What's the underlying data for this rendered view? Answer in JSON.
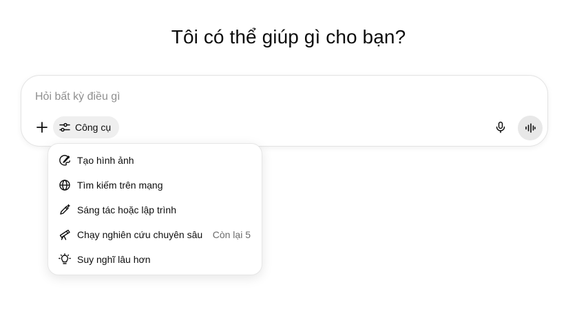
{
  "heading": "Tôi có thể giúp gì cho bạn?",
  "composer": {
    "placeholder": "Hỏi bất kỳ điều gì",
    "value": "",
    "tools_label": "Công cụ"
  },
  "tools_menu": {
    "items": [
      {
        "label": "Tạo hình ảnh",
        "icon": "image-brush-icon"
      },
      {
        "label": "Tìm kiếm trên mạng",
        "icon": "globe-icon"
      },
      {
        "label": "Sáng tác hoặc lập trình",
        "icon": "pen-sparkle-icon"
      },
      {
        "label": "Chạy nghiên cứu chuyên sâu",
        "icon": "telescope-icon",
        "meta": "Còn lại 5"
      },
      {
        "label": "Suy nghĩ lâu hơn",
        "icon": "lightbulb-icon"
      }
    ]
  }
}
